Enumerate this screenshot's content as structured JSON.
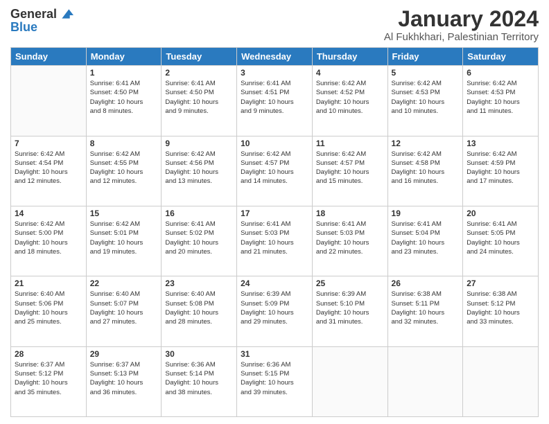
{
  "logo": {
    "general": "General",
    "blue": "Blue"
  },
  "title": "January 2024",
  "location": "Al Fukhkhari, Palestinian Territory",
  "headers": [
    "Sunday",
    "Monday",
    "Tuesday",
    "Wednesday",
    "Thursday",
    "Friday",
    "Saturday"
  ],
  "weeks": [
    [
      {
        "day": "",
        "info": ""
      },
      {
        "day": "1",
        "info": "Sunrise: 6:41 AM\nSunset: 4:50 PM\nDaylight: 10 hours\nand 8 minutes."
      },
      {
        "day": "2",
        "info": "Sunrise: 6:41 AM\nSunset: 4:50 PM\nDaylight: 10 hours\nand 9 minutes."
      },
      {
        "day": "3",
        "info": "Sunrise: 6:41 AM\nSunset: 4:51 PM\nDaylight: 10 hours\nand 9 minutes."
      },
      {
        "day": "4",
        "info": "Sunrise: 6:42 AM\nSunset: 4:52 PM\nDaylight: 10 hours\nand 10 minutes."
      },
      {
        "day": "5",
        "info": "Sunrise: 6:42 AM\nSunset: 4:53 PM\nDaylight: 10 hours\nand 10 minutes."
      },
      {
        "day": "6",
        "info": "Sunrise: 6:42 AM\nSunset: 4:53 PM\nDaylight: 10 hours\nand 11 minutes."
      }
    ],
    [
      {
        "day": "7",
        "info": "Sunrise: 6:42 AM\nSunset: 4:54 PM\nDaylight: 10 hours\nand 12 minutes."
      },
      {
        "day": "8",
        "info": "Sunrise: 6:42 AM\nSunset: 4:55 PM\nDaylight: 10 hours\nand 12 minutes."
      },
      {
        "day": "9",
        "info": "Sunrise: 6:42 AM\nSunset: 4:56 PM\nDaylight: 10 hours\nand 13 minutes."
      },
      {
        "day": "10",
        "info": "Sunrise: 6:42 AM\nSunset: 4:57 PM\nDaylight: 10 hours\nand 14 minutes."
      },
      {
        "day": "11",
        "info": "Sunrise: 6:42 AM\nSunset: 4:57 PM\nDaylight: 10 hours\nand 15 minutes."
      },
      {
        "day": "12",
        "info": "Sunrise: 6:42 AM\nSunset: 4:58 PM\nDaylight: 10 hours\nand 16 minutes."
      },
      {
        "day": "13",
        "info": "Sunrise: 6:42 AM\nSunset: 4:59 PM\nDaylight: 10 hours\nand 17 minutes."
      }
    ],
    [
      {
        "day": "14",
        "info": "Sunrise: 6:42 AM\nSunset: 5:00 PM\nDaylight: 10 hours\nand 18 minutes."
      },
      {
        "day": "15",
        "info": "Sunrise: 6:42 AM\nSunset: 5:01 PM\nDaylight: 10 hours\nand 19 minutes."
      },
      {
        "day": "16",
        "info": "Sunrise: 6:41 AM\nSunset: 5:02 PM\nDaylight: 10 hours\nand 20 minutes."
      },
      {
        "day": "17",
        "info": "Sunrise: 6:41 AM\nSunset: 5:03 PM\nDaylight: 10 hours\nand 21 minutes."
      },
      {
        "day": "18",
        "info": "Sunrise: 6:41 AM\nSunset: 5:03 PM\nDaylight: 10 hours\nand 22 minutes."
      },
      {
        "day": "19",
        "info": "Sunrise: 6:41 AM\nSunset: 5:04 PM\nDaylight: 10 hours\nand 23 minutes."
      },
      {
        "day": "20",
        "info": "Sunrise: 6:41 AM\nSunset: 5:05 PM\nDaylight: 10 hours\nand 24 minutes."
      }
    ],
    [
      {
        "day": "21",
        "info": "Sunrise: 6:40 AM\nSunset: 5:06 PM\nDaylight: 10 hours\nand 25 minutes."
      },
      {
        "day": "22",
        "info": "Sunrise: 6:40 AM\nSunset: 5:07 PM\nDaylight: 10 hours\nand 27 minutes."
      },
      {
        "day": "23",
        "info": "Sunrise: 6:40 AM\nSunset: 5:08 PM\nDaylight: 10 hours\nand 28 minutes."
      },
      {
        "day": "24",
        "info": "Sunrise: 6:39 AM\nSunset: 5:09 PM\nDaylight: 10 hours\nand 29 minutes."
      },
      {
        "day": "25",
        "info": "Sunrise: 6:39 AM\nSunset: 5:10 PM\nDaylight: 10 hours\nand 31 minutes."
      },
      {
        "day": "26",
        "info": "Sunrise: 6:38 AM\nSunset: 5:11 PM\nDaylight: 10 hours\nand 32 minutes."
      },
      {
        "day": "27",
        "info": "Sunrise: 6:38 AM\nSunset: 5:12 PM\nDaylight: 10 hours\nand 33 minutes."
      }
    ],
    [
      {
        "day": "28",
        "info": "Sunrise: 6:37 AM\nSunset: 5:12 PM\nDaylight: 10 hours\nand 35 minutes."
      },
      {
        "day": "29",
        "info": "Sunrise: 6:37 AM\nSunset: 5:13 PM\nDaylight: 10 hours\nand 36 minutes."
      },
      {
        "day": "30",
        "info": "Sunrise: 6:36 AM\nSunset: 5:14 PM\nDaylight: 10 hours\nand 38 minutes."
      },
      {
        "day": "31",
        "info": "Sunrise: 6:36 AM\nSunset: 5:15 PM\nDaylight: 10 hours\nand 39 minutes."
      },
      {
        "day": "",
        "info": ""
      },
      {
        "day": "",
        "info": ""
      },
      {
        "day": "",
        "info": ""
      }
    ]
  ]
}
